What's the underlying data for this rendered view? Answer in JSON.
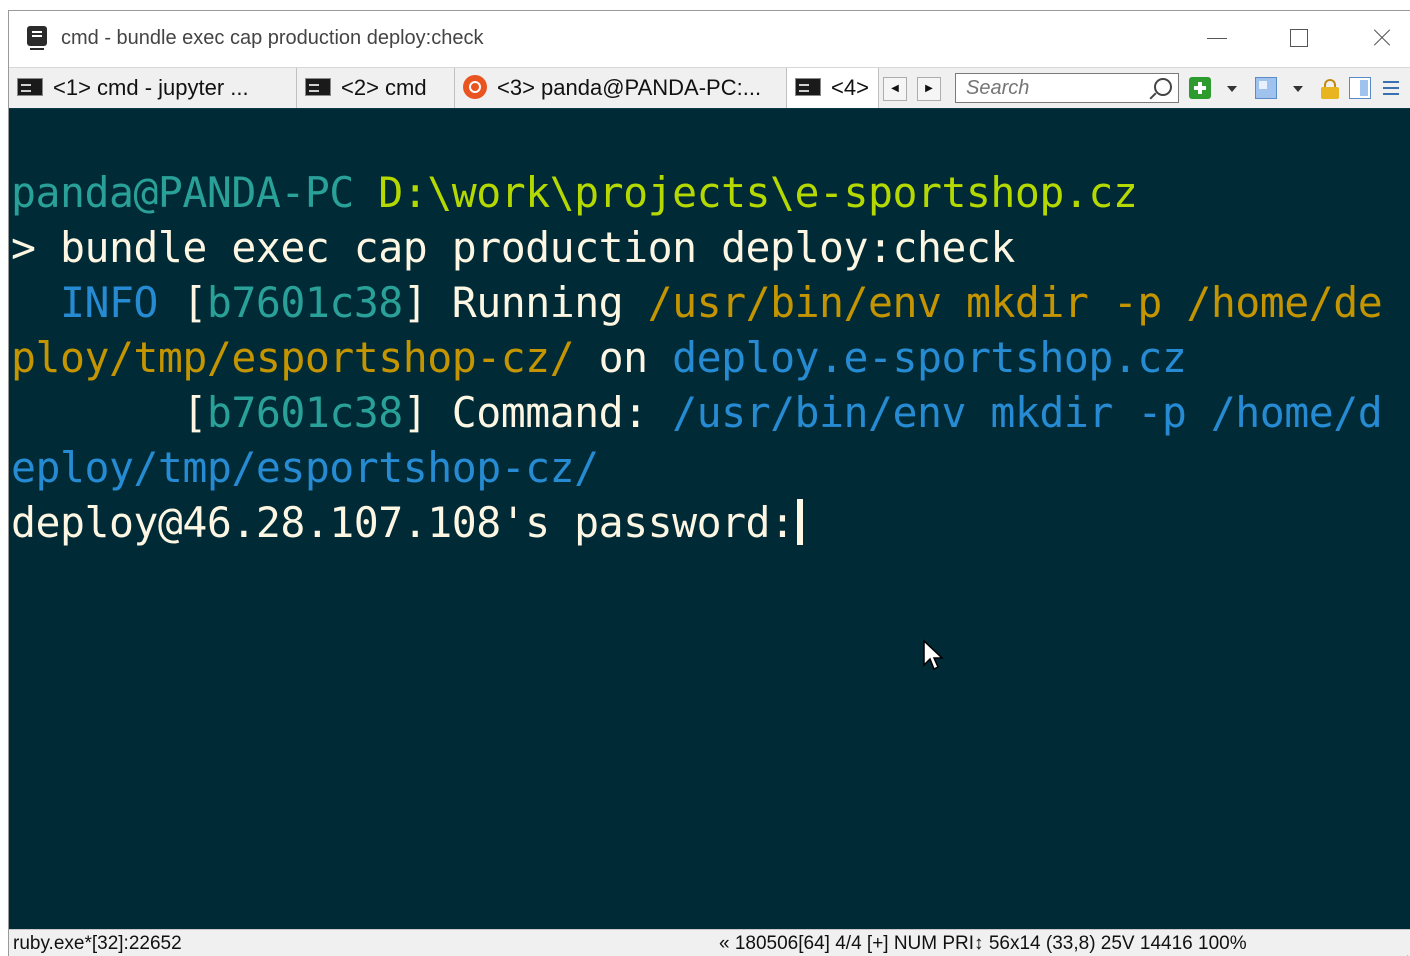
{
  "window": {
    "title": "cmd - bundle  exec cap production deploy:check"
  },
  "tabs": [
    {
      "label": "<1> cmd - jupyter ...",
      "icon": "cmd-icon"
    },
    {
      "label": "<2> cmd",
      "icon": "cmd-icon"
    },
    {
      "label": "<3> panda@PANDA-PC:...",
      "icon": "ubuntu-icon"
    },
    {
      "label": "<4>",
      "icon": "cmd-icon",
      "active": true
    }
  ],
  "search": {
    "placeholder": "Search"
  },
  "terminal": {
    "lines": [
      [
        {
          "text": "panda@PANDA-PC ",
          "color": "#2aa198"
        },
        {
          "text": "D:\\work\\projects\\e-sportshop.cz",
          "color": "#b5d900"
        }
      ],
      [
        {
          "text": "> bundle exec cap production deploy:check",
          "color": "#fdf6e3"
        }
      ],
      [
        {
          "text": "  INFO ",
          "color": "#268bd2"
        },
        {
          "text": "[",
          "color": "#fdf6e3"
        },
        {
          "text": "b7601c38",
          "color": "#2aa198"
        },
        {
          "text": "] Running ",
          "color": "#fdf6e3"
        },
        {
          "text": "/usr/bin/env mkdir -p /home/de",
          "color": "#c49500"
        }
      ],
      [
        {
          "text": "ploy/tmp/esportshop-cz/",
          "color": "#c49500"
        },
        {
          "text": " on ",
          "color": "#fdf6e3"
        },
        {
          "text": "deploy.e-sportshop.cz",
          "color": "#268bd2"
        }
      ],
      [
        {
          "text": "       [",
          "color": "#fdf6e3"
        },
        {
          "text": "b7601c38",
          "color": "#2aa198"
        },
        {
          "text": "] Command: ",
          "color": "#fdf6e3"
        },
        {
          "text": "/usr/bin/env mkdir -p /home/d",
          "color": "#268bd2"
        }
      ],
      [
        {
          "text": "eploy/tmp/esportshop-cz/",
          "color": "#268bd2"
        }
      ],
      [
        {
          "text": "deploy@46.28.107.108's password:",
          "color": "#fdf6e3"
        }
      ]
    ]
  },
  "status": {
    "process": "ruby.exe*[32]:22652",
    "right": "« 180506[64]   4/4   [+] NUM   PRI↕   56x14     (33,8) 25V     14416 100%"
  },
  "colors": {
    "terminal_bg": "#002b36",
    "prompt_user": "#2aa198",
    "prompt_path": "#b5d900"
  }
}
